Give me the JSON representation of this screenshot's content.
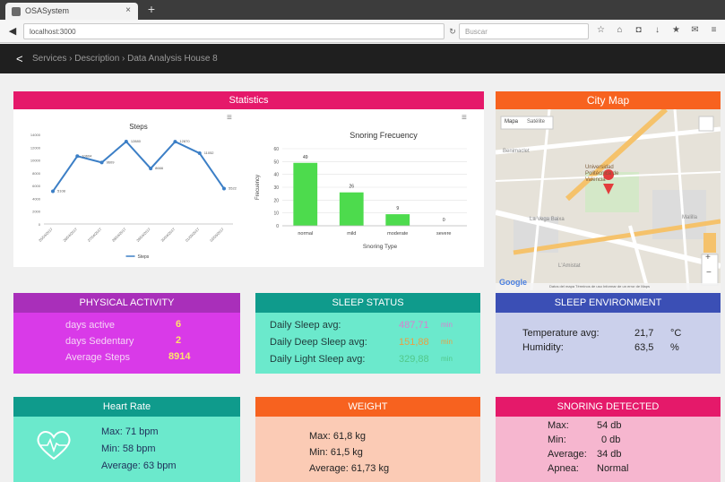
{
  "browser": {
    "tab_title": "OSASystem",
    "tab_close": "×",
    "new_tab": "+",
    "back": "◀",
    "url": "localhost:3000",
    "reload": "↻",
    "search_placeholder": "Buscar",
    "toolbar_icons": [
      "star-icon",
      "home-icon",
      "pocket-icon",
      "download-icon",
      "bookmark-icon",
      "chat-icon",
      "menu-icon"
    ],
    "toolbar_glyphs": [
      "☆",
      "⌂",
      "◘",
      "↓",
      "★",
      "✉",
      "≡"
    ]
  },
  "header": {
    "back": "<",
    "breadcrumb": "Services › Description › Data Analysis House 8"
  },
  "statistics": {
    "title": "Statistics",
    "menu": "≡"
  },
  "city_map": {
    "title": "City Map",
    "map_btn": "Mapa",
    "sat_btn": "Satélite",
    "label_1": "Universidad Politécnica de Valencia",
    "road_1": "La Vega Baixa",
    "road_2": "Malilla",
    "road_3": "L'Amistat",
    "road_4": "Benimaclet",
    "google": "Google",
    "zoom_in": "+",
    "zoom_out": "−",
    "footer": "Datos del mapa   Términos de uso   Informar de un error de Maps"
  },
  "physical_activity": {
    "title": "PHYSICAL ACTIVITY",
    "rows": [
      {
        "label": "days active",
        "value": "6"
      },
      {
        "label": "days Sedentary",
        "value": "2"
      },
      {
        "label": "Average Steps",
        "value": "8914"
      }
    ]
  },
  "sleep_status": {
    "title": "SLEEP STATUS",
    "rows": [
      {
        "label": "Daily Sleep avg:",
        "value": "487,71",
        "unit": "min"
      },
      {
        "label": "Daily Deep Sleep avg:",
        "value": "151,88",
        "unit": "min"
      },
      {
        "label": "Daily Light Sleep avg:",
        "value": "329,88",
        "unit": "min"
      }
    ]
  },
  "sleep_environment": {
    "title": "SLEEP ENVIRONMENT",
    "rows": [
      {
        "label": "Temperature avg:",
        "value": "21,7",
        "unit": "°C"
      },
      {
        "label": "Humidity:",
        "value": "63,5",
        "unit": "%"
      }
    ]
  },
  "heart_rate": {
    "title": "Heart Rate",
    "rows": [
      {
        "text": "Max:  71  bpm"
      },
      {
        "text": "Min:  58  bpm"
      },
      {
        "text": "Average:  63 bpm"
      }
    ]
  },
  "weight": {
    "title": "WEIGHT",
    "rows": [
      {
        "text": "Max:   61,8   kg"
      },
      {
        "text": "Min:   61,5   kg"
      },
      {
        "text": "Average: 61,73 kg"
      }
    ]
  },
  "snoring": {
    "title": "SNORING DETECTED",
    "rows": [
      {
        "label": "Max:",
        "value": "54 db"
      },
      {
        "label": "Min:",
        "value": "0 db"
      },
      {
        "label": "Average:",
        "value": "34 db"
      },
      {
        "label": "Apnea:",
        "value": "Normal"
      }
    ]
  },
  "colors": {
    "pink": "#e5196a",
    "orange": "#f7621f",
    "purple": "#a92fba",
    "teal": "#0f9b8c",
    "indigo": "#3b4fb5",
    "line": "#3c7fc6",
    "bar": "#4ddb4d",
    "value_yellow": "#ffe26b",
    "value_pink": "#d880d0",
    "value_orange": "#e8a044",
    "value_green": "#52c88a"
  },
  "chart_data": [
    {
      "type": "line",
      "title": "Steps",
      "xlabel": "",
      "ylabel": "",
      "categories": [
        "25/04/2017",
        "26/04/2017",
        "27/04/2017",
        "28/04/2017",
        "29/04/2017",
        "30/04/2017",
        "01/05/2017",
        "02/05/2017"
      ],
      "series": [
        {
          "name": "Steps",
          "values": [
            5108,
            10604,
            9609,
            12880,
            8666,
            12870,
            11052,
            5522
          ]
        }
      ],
      "data_labels": [
        "5108",
        "10604",
        "9609",
        "12880",
        "8666",
        "12870",
        "11052",
        "5522"
      ],
      "ylim": [
        0,
        14000
      ],
      "yticks": [
        "0",
        "2000",
        "4000",
        "6000",
        "8000",
        "10000",
        "12000",
        "14000"
      ],
      "legend": "bottom",
      "grid": false
    },
    {
      "type": "bar",
      "title": "Snoring Frecuency",
      "xlabel": "Snoring Type",
      "ylabel": "Frecuency",
      "categories": [
        "normal",
        "mild",
        "moderate",
        "severe"
      ],
      "values": [
        49,
        26,
        9,
        0
      ],
      "ylim": [
        0,
        60
      ],
      "yticks": [
        "0",
        "10",
        "20",
        "30",
        "40",
        "50",
        "60"
      ],
      "grid": true
    }
  ]
}
